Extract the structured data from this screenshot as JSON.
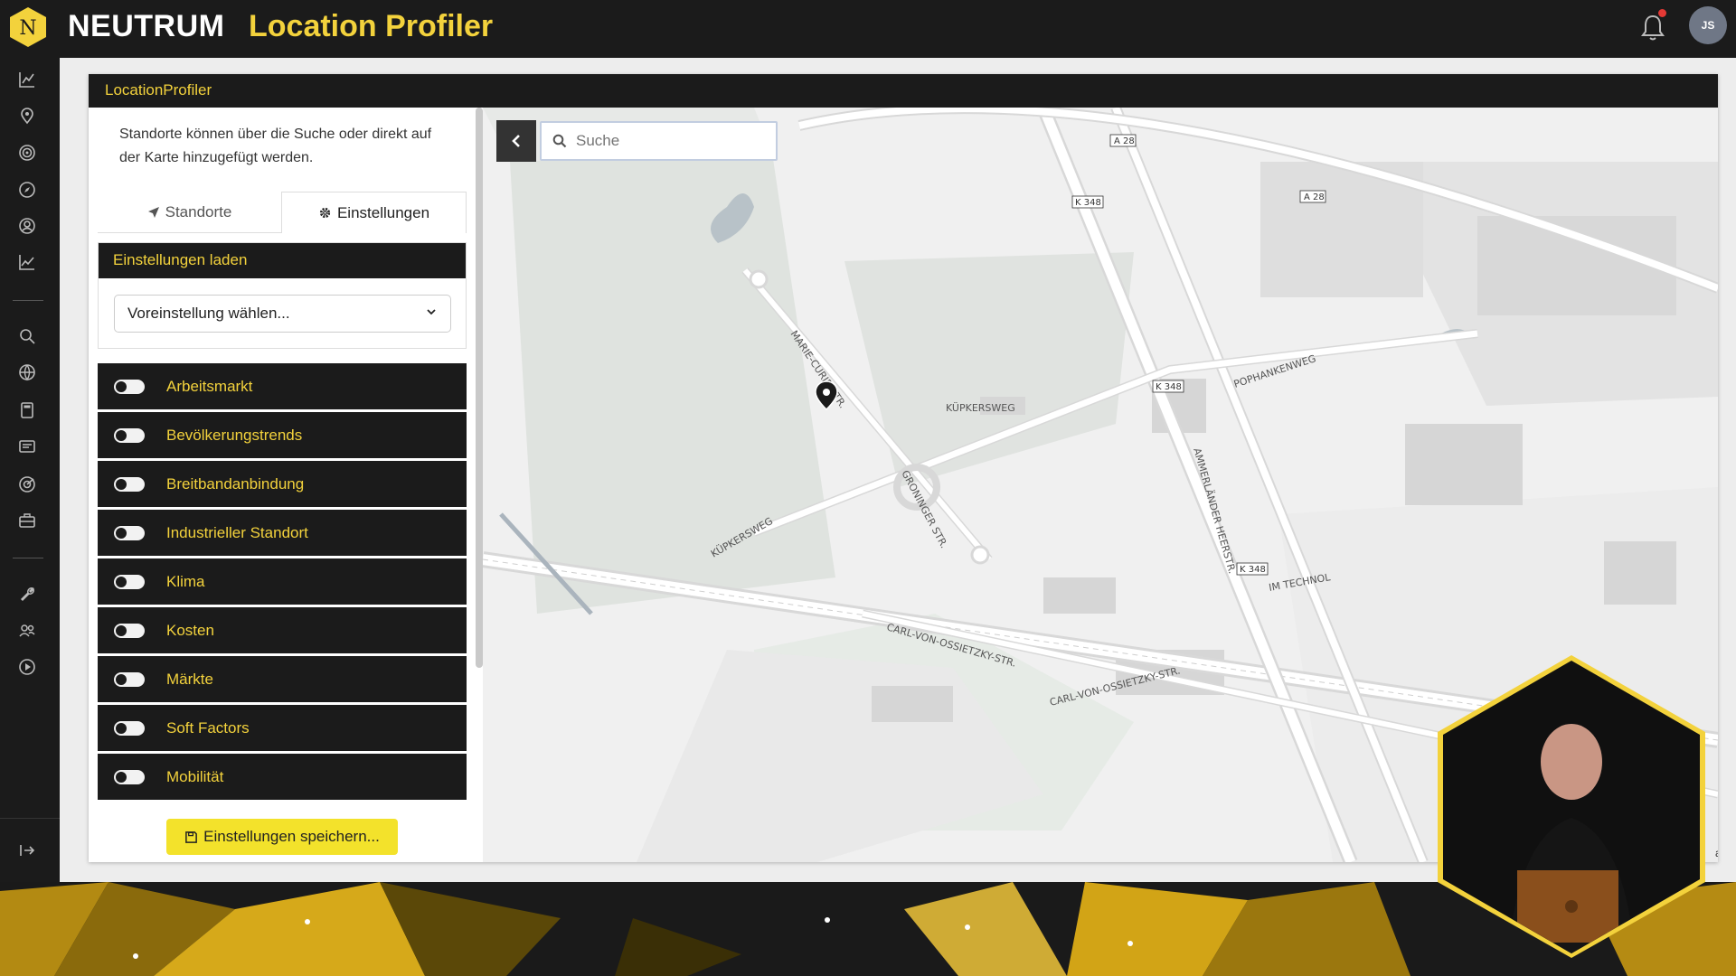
{
  "header": {
    "logo_letter": "N",
    "brand": "NEUTRUM",
    "title": "Location Profiler",
    "avatar_initials": "JS",
    "accent_color": "#f3d23c",
    "notification_icon": "bell-icon"
  },
  "panel": {
    "title": "LocationProfiler",
    "intro_text": "Standorte können über die Suche oder direkt auf der Karte hinzugefügt werden.",
    "tabs": [
      {
        "label": "Standorte",
        "icon": "location-arrow-icon"
      },
      {
        "label": "Einstellungen",
        "icon": "gear-icon"
      }
    ],
    "load_settings": {
      "title": "Einstellungen laden",
      "select_value": "Voreinstellung wählen..."
    },
    "toggles": [
      {
        "label": "Arbeitsmarkt"
      },
      {
        "label": "Bevölkerungstrends"
      },
      {
        "label": "Breitbandanbindung"
      },
      {
        "label": "Industrieller Standort"
      },
      {
        "label": "Klima"
      },
      {
        "label": "Kosten"
      },
      {
        "label": "Märkte"
      },
      {
        "label": "Soft Factors"
      },
      {
        "label": "Mobilität"
      }
    ],
    "save_button": "Einstellungen speichern..."
  },
  "map": {
    "search_placeholder": "Suche",
    "attribution": "ap",
    "labels": {
      "a28_1": "A 28",
      "a28_2": "A 28",
      "k348_1": "K 348",
      "k348_2": "K 348",
      "k348_3": "K 348",
      "street1": "MARIE-CURIE-STR.",
      "street2": "KÜPKERSWEG",
      "street3": "KÜPKERSWEG",
      "street4": "POPHANKENWEG",
      "street5": "GRONINGER STR.",
      "street6": "AMMERLÄNDER HEERSTR.",
      "street7": "CARL-VON-OSSIETZKY-STR.",
      "street8": "CARL-VON-OSSIETZKY-STR.",
      "street9": "IM TECHNOL"
    }
  }
}
